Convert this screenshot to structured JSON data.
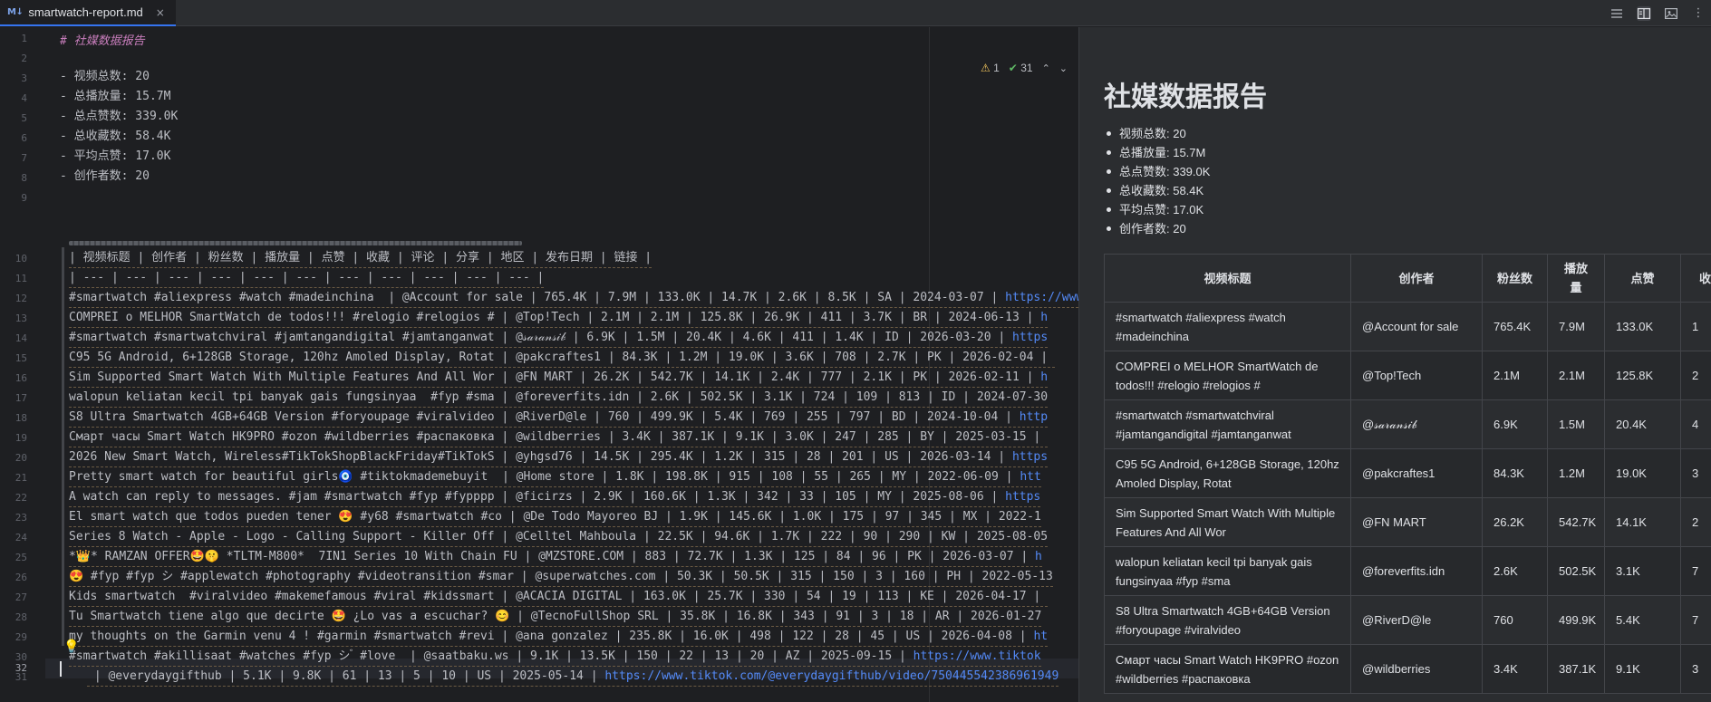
{
  "tab": {
    "icon": "M↓",
    "file_name": "smartwatch-report.md",
    "close": "×"
  },
  "toolbar_icons": [
    "editor-only-icon",
    "editor-and-preview-icon",
    "preview-only-icon",
    "more-icon"
  ],
  "inspection": {
    "warnings": "1",
    "checks": "31"
  },
  "colors": {
    "accent": "#3574f0",
    "link": "#548af7",
    "heading": "#c77dbb",
    "warning": "#f2c55c",
    "ok": "#5fb865"
  },
  "editor": {
    "line_numbers": [
      "1",
      "2",
      "3",
      "4",
      "5",
      "6",
      "7",
      "8",
      "9",
      "10",
      "11",
      "12",
      "13",
      "14",
      "15",
      "16",
      "17",
      "18",
      "19",
      "20",
      "21",
      "22",
      "23",
      "24",
      "25",
      "26",
      "27",
      "28",
      "29",
      "30",
      "31",
      "32"
    ],
    "heading_line": "# 社媒数据报告",
    "stat_lines": [
      "- 视频总数: 20",
      "- 总播放量: 15.7M",
      "- 总点赞数: 339.0K",
      "- 总收藏数: 58.4K",
      "- 平均点赞: 17.0K",
      "- 创作者数: 20"
    ],
    "table_header_line": "| 视频标题 | 创作者 | 粉丝数 | 播放量 | 点赞 | 收藏 | 评论 | 分享 | 地区 | 发布日期 | 链接 |",
    "table_sep_line": "| --- | --- | --- | --- | --- | --- | --- | --- | --- | --- | --- |",
    "table_rows": [
      {
        "text": "#smartwatch #aliexpress #watch #madeinchina  | @Account for sale | 765.4K | 7.9M | 133.0K | 14.7K | 2.6K | 8.5K | SA | 2024-03-07 | ",
        "link": "https://www"
      },
      {
        "text": "COMPREI o MELHOR SmartWatch de todos!!! #relogio #relogios # | @Top!Tech | 2.1M | 2.1M | 125.8K | 26.9K | 411 | 3.7K | BR | 2024-06-13 | ",
        "link": "h"
      },
      {
        "text": "#smartwatch #smartwatchviral #jamtangandigital #jamtanganwat | @𝓈𝒶𝓇𝒶𝓃𝓈𝒾𝒷 | 6.9K | 1.5M | 20.4K | 4.6K | 411 | 1.4K | ID | 2026-03-20 | ",
        "link": "https"
      },
      {
        "text": "C95 5G Android, 6+128GB Storage, 120hz Amoled Display, Rotat | @pakcraftes1 | 84.3K | 1.2M | 19.0K | 3.6K | 708 | 2.7K | PK | 2026-02-04 | ",
        "link": ""
      },
      {
        "text": "Sim Supported Smart Watch With Multiple Features And All Wor | @FN MART | 26.2K | 542.7K | 14.1K | 2.4K | 777 | 2.1K | PK | 2026-02-11 | ",
        "link": "h"
      },
      {
        "text": "walopun keliatan kecil tpi banyak gais fungsinyaa  #fyp #sma | @foreverfits.idn | 2.6K | 502.5K | 3.1K | 724 | 109 | 813 | ID | 2024-07-30",
        "link": ""
      },
      {
        "text": "S8 Ultra Smartwatch 4GB+64GB Version #foryoupage #viralvideo | @RiverD@le | 760 | 499.9K | 5.4K | 769 | 255 | 797 | BD | 2024-10-04 | ",
        "link": "http"
      },
      {
        "text": "Смарт часы Smart Watch HK9PRO #ozon #wildberries #распаковка | @wildberries | 3.4K | 387.1K | 9.1K | 3.0K | 247 | 285 | BY | 2025-03-15 | ",
        "link": ""
      },
      {
        "text": "2026 New Smart Watch, Wireless#TikTokShopBlackFriday#TikTokS | @yhgsd76 | 14.5K | 295.4K | 1.2K | 315 | 28 | 201 | US | 2026-03-14 | ",
        "link": "https"
      },
      {
        "text": "Pretty smart watch for beautiful girls🧿 #tiktokmademebuyit  | @Home store | 1.8K | 198.8K | 915 | 108 | 55 | 265 | MY | 2022-06-09 | ",
        "link": "htt"
      },
      {
        "text": "A watch can reply to messages. #jam #smartwatch #fyp #fypppp | @ficirzs | 2.9K | 160.6K | 1.3K | 342 | 33 | 105 | MY | 2025-08-06 | ",
        "link": "https"
      },
      {
        "text": "El smart watch que todos pueden tener 😍 #y68 #smartwatch #co | @De Todo Mayoreo BJ | 1.9K | 145.6K | 1.0K | 175 | 97 | 345 | MX | 2022-1",
        "link": ""
      },
      {
        "text": "Series 8 Watch - Apple - Logo - Calling Support - Killer Off | @Celltel Mahboula | 22.5K | 94.6K | 1.7K | 222 | 90 | 290 | KW | 2025-08-05",
        "link": ""
      },
      {
        "text": "*👑* RAMZAN OFFER🤩🤫 *TLTM-M800*  7IN1 Series 10 With Chain FU | @MZSTORE.COM | 883 | 72.7K | 1.3K | 125 | 84 | 96 | PK | 2026-03-07 | ",
        "link": "h"
      },
      {
        "text": "😍 #fyp #fyp シ #applewatch #photography #videotransition #smar | @superwatches.com | 50.3K | 50.5K | 315 | 150 | 3 | 160 | PH | 2022-05-13",
        "link": ""
      },
      {
        "text": "Kids smartwatch  #viralvideo #makemefamous #viral #kidssmart | @ACACIA DIGITAL | 163.0K | 25.7K | 330 | 54 | 19 | 113 | KE | 2026-04-17 | ",
        "link": ""
      },
      {
        "text": "Tu Smartwatch tiene algo que decirte 🤩 ¿Lo vas a escuchar? 😊 | @TecnoFullShop SRL | 35.8K | 16.8K | 343 | 91 | 3 | 18 | AR | 2026-01-27",
        "link": ""
      },
      {
        "text": "my thoughts on the Garmin venu 4 ! #garmin #smartwatch #revi | @ana gonzalez | 235.8K | 16.0K | 498 | 122 | 28 | 45 | US | 2026-04-08 | ",
        "link": "ht"
      },
      {
        "text": "#smartwatch #akillisaat #watches #fyp シ ゙ #love  | @saatbaku.ws | 9.1K | 13.5K | 150 | 22 | 13 | 20 | AZ | 2025-09-15 | ",
        "link": "https://www.tiktok"
      },
      {
        "text": " | @everydaygifthub | 5.1K | 9.8K | 61 | 13 | 5 | 10 | US | 2025-05-14 | ",
        "link": "https://www.tiktok.com/@everydaygifthub/video/750445542386961949"
      }
    ]
  },
  "preview": {
    "title": "社媒数据报告",
    "stats": [
      "视频总数: 20",
      "总播放量: 15.7M",
      "总点赞数: 339.0K",
      "总收藏数: 58.4K",
      "平均点赞: 17.0K",
      "创作者数: 20"
    ],
    "table_headers": [
      "视频标题",
      "创作者",
      "粉丝数",
      "播放量",
      "点赞",
      "收"
    ],
    "table_rows": [
      [
        "#smartwatch #aliexpress #watch #madeinchina",
        "@Account for sale",
        "765.4K",
        "7.9M",
        "133.0K",
        "1"
      ],
      [
        "COMPREI o MELHOR SmartWatch de todos!!! #relogio #relogios #",
        "@Top!Tech",
        "2.1M",
        "2.1M",
        "125.8K",
        "2"
      ],
      [
        "#smartwatch #smartwatchviral #jamtangandigital #jamtanganwat",
        "@𝓈𝒶𝓇𝒶𝓃𝓈𝒾𝒷",
        "6.9K",
        "1.5M",
        "20.4K",
        "4"
      ],
      [
        "C95 5G Android, 6+128GB Storage, 120hz Amoled Display, Rotat",
        "@pakcraftes1",
        "84.3K",
        "1.2M",
        "19.0K",
        "3"
      ],
      [
        "Sim Supported Smart Watch With Multiple Features And All Wor",
        "@FN MART",
        "26.2K",
        "542.7K",
        "14.1K",
        "2"
      ],
      [
        "walopun keliatan kecil tpi banyak gais fungsinyaa #fyp #sma",
        "@foreverfits.idn",
        "2.6K",
        "502.5K",
        "3.1K",
        "7"
      ],
      [
        "S8 Ultra Smartwatch 4GB+64GB Version #foryoupage #viralvideo",
        "@RiverD@le",
        "760",
        "499.9K",
        "5.4K",
        "7"
      ],
      [
        "Смарт часы Smart Watch HK9PRO #ozon #wildberries #распаковка",
        "@wildberries",
        "3.4K",
        "387.1K",
        "9.1K",
        "3"
      ]
    ]
  }
}
